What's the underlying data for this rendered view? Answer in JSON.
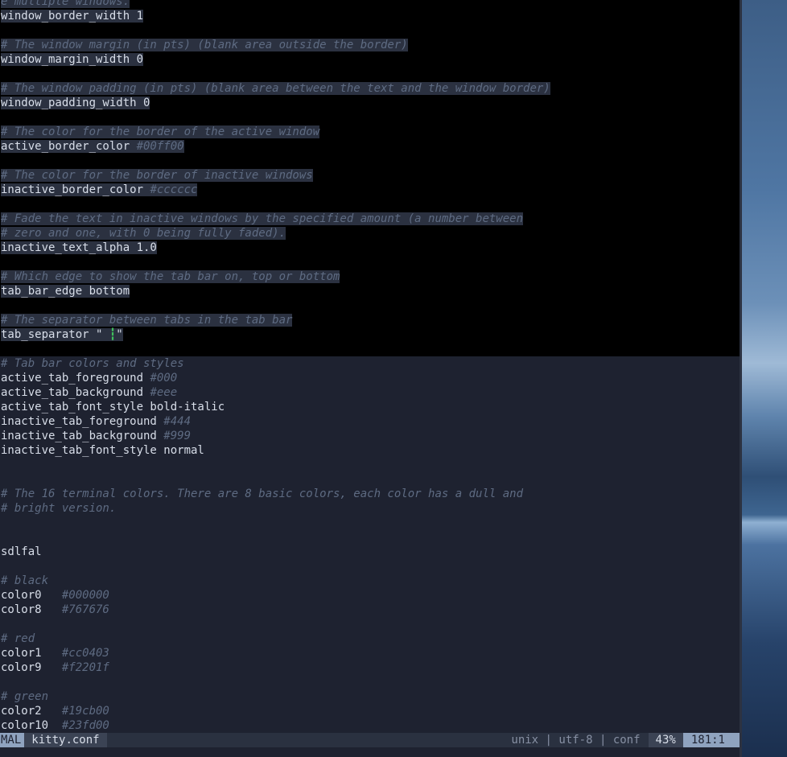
{
  "top_lines": [
    {
      "text": "e multiple windows.",
      "type": "comment",
      "hl": true
    },
    {
      "text": "window_border_width 1",
      "type": "code",
      "hl": true
    },
    {
      "text": "",
      "type": "blank",
      "hl": false
    },
    {
      "text": "# The window margin (in pts) (blank area outside the border)",
      "type": "comment",
      "hl": true
    },
    {
      "text": "window_margin_width 0",
      "type": "code",
      "hl": true
    },
    {
      "text": "",
      "type": "blank",
      "hl": false
    },
    {
      "text": "# The window padding (in pts) (blank area between the text and the window border)",
      "type": "comment",
      "hl": true
    },
    {
      "text": "window_padding_width 0",
      "type": "code",
      "hl": true
    },
    {
      "text": "",
      "type": "blank",
      "hl": false
    },
    {
      "text": "# The color for the border of the active window",
      "type": "comment",
      "hl": true
    },
    {
      "text": "active_border_color ",
      "value": "#00ff00",
      "type": "code",
      "hl": true
    },
    {
      "text": "",
      "type": "blank",
      "hl": false
    },
    {
      "text": "# The color for the border of inactive windows",
      "type": "comment",
      "hl": true
    },
    {
      "text": "inactive_border_color ",
      "value": "#cccccc",
      "type": "code",
      "hl": true
    },
    {
      "text": "",
      "type": "blank",
      "hl": false
    },
    {
      "text": "# Fade the text in inactive windows by the specified amount (a number between",
      "type": "comment",
      "hl": true
    },
    {
      "text": "# zero and one, with 0 being fully faded).",
      "type": "comment",
      "hl": true
    },
    {
      "text": "inactive_text_alpha 1.0",
      "type": "code",
      "hl": true
    },
    {
      "text": "",
      "type": "blank",
      "hl": false
    },
    {
      "text": "# Which edge to show the tab bar on, top or bottom",
      "type": "comment",
      "hl": true
    },
    {
      "text": "tab_bar_edge bottom",
      "type": "code",
      "hl": true
    },
    {
      "text": "",
      "type": "blank",
      "hl": false
    },
    {
      "text": "# The separator between tabs in the tab bar",
      "type": "comment",
      "hl": true
    },
    {
      "text": "tab_separator \" ",
      "cursor": "┇",
      "after": "\"",
      "type": "code",
      "hl": true
    }
  ],
  "bottom_lines": [
    {
      "text": "# Tab bar colors and styles",
      "type": "comment"
    },
    {
      "text": "active_tab_foreground ",
      "value": "#000",
      "type": "code"
    },
    {
      "text": "active_tab_background ",
      "value": "#eee",
      "type": "code"
    },
    {
      "text": "active_tab_font_style bold-italic",
      "type": "code"
    },
    {
      "text": "inactive_tab_foreground ",
      "value": "#444",
      "type": "code"
    },
    {
      "text": "inactive_tab_background ",
      "value": "#999",
      "type": "code"
    },
    {
      "text": "inactive_tab_font_style normal",
      "type": "code"
    },
    {
      "text": "",
      "type": "blank"
    },
    {
      "text": "",
      "type": "blank"
    },
    {
      "text": "# The 16 terminal colors. There are 8 basic colors, each color has a dull and",
      "type": "comment"
    },
    {
      "text": "# bright version.",
      "type": "comment"
    },
    {
      "text": "",
      "type": "blank"
    },
    {
      "text": "",
      "type": "blank"
    },
    {
      "text": "sdlfal",
      "type": "code"
    },
    {
      "text": "",
      "type": "blank"
    },
    {
      "text": "# black",
      "type": "comment"
    },
    {
      "text": "color0   ",
      "value": "#000000",
      "type": "code"
    },
    {
      "text": "color8   ",
      "value": "#767676",
      "type": "code"
    },
    {
      "text": "",
      "type": "blank"
    },
    {
      "text": "# red",
      "type": "comment"
    },
    {
      "text": "color1   ",
      "value": "#cc0403",
      "type": "code"
    },
    {
      "text": "color9   ",
      "value": "#f2201f",
      "type": "code"
    },
    {
      "text": "",
      "type": "blank"
    },
    {
      "text": "# green",
      "type": "comment"
    },
    {
      "text": "color2   ",
      "value": "#19cb00",
      "type": "code"
    },
    {
      "text": "color10  ",
      "value": "#23fd00",
      "type": "code"
    }
  ],
  "status": {
    "mode": "MAL",
    "filename": "kitty.conf",
    "fileinfo": "unix | utf-8 | conf",
    "percent": "43%",
    "position": "181:1"
  }
}
